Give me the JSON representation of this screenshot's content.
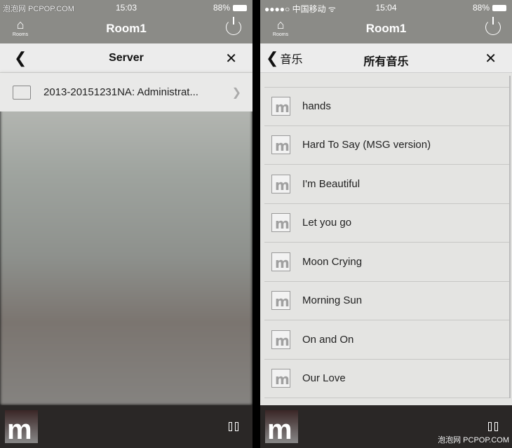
{
  "watermark": "泡泡网 PCPOP.COM",
  "left": {
    "status": {
      "time": "15:03",
      "battery": "88%"
    },
    "header": {
      "title": "Room1",
      "rooms_label": "Rooms"
    },
    "nav": {
      "title": "Server"
    },
    "items": [
      {
        "label": "2013-20151231NA: Administrat..."
      }
    ]
  },
  "right": {
    "status": {
      "carrier": "●●●●○ 中国移动 ᯤ",
      "time": "15:04",
      "battery": "88%"
    },
    "header": {
      "title": "Room1",
      "rooms_label": "Rooms"
    },
    "nav": {
      "back_label": "音乐",
      "title": "所有音乐"
    },
    "songs": [
      {
        "label": "hands"
      },
      {
        "label": "Hard To Say (MSG version)"
      },
      {
        "label": "I'm Beautiful"
      },
      {
        "label": "Let you go"
      },
      {
        "label": "Moon Crying"
      },
      {
        "label": "Morning Sun"
      },
      {
        "label": "On and On"
      },
      {
        "label": "Our Love"
      }
    ]
  },
  "player": {
    "logo": "m"
  }
}
